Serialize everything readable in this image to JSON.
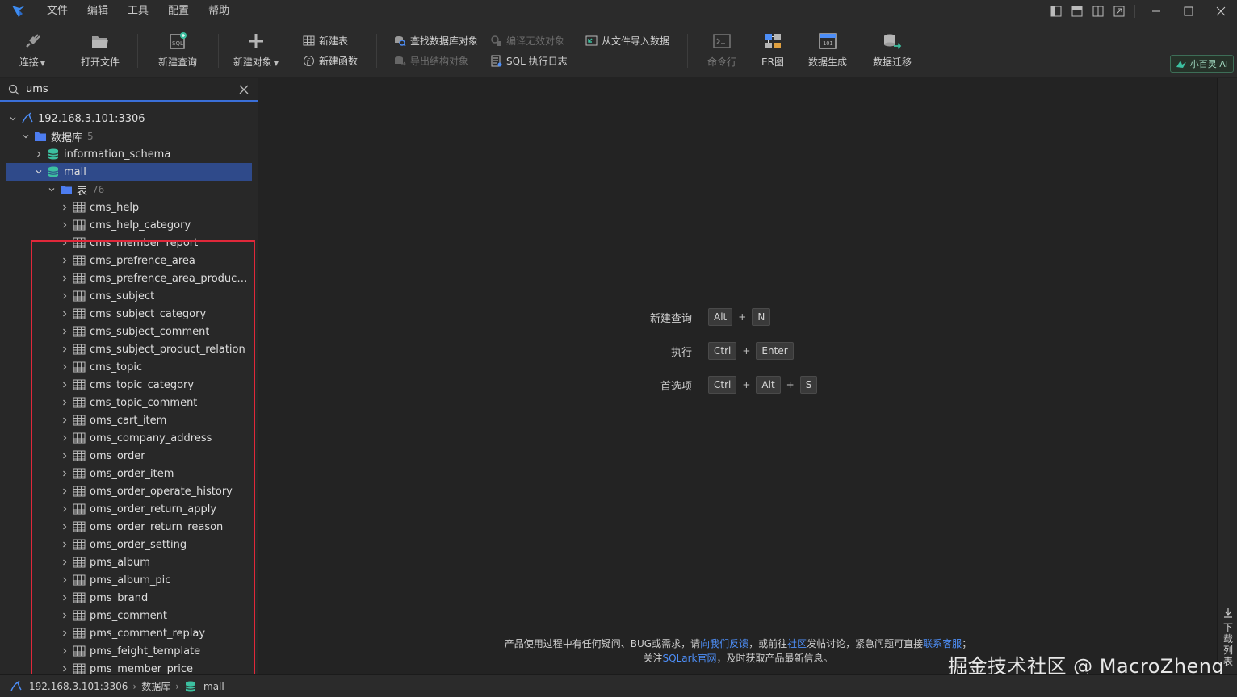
{
  "menu": [
    "文件",
    "编辑",
    "工具",
    "配置",
    "帮助"
  ],
  "toolbar": {
    "connect": "连接",
    "open_file": "打开文件",
    "new_query": "新建查询",
    "new_object": "新建对象",
    "new_table": "新建表",
    "new_function": "新建函数",
    "find_db_object": "查找数据库对象",
    "export_structure": "导出结构对象",
    "compile_invalid": "编译无效对象",
    "sql_log": "SQL 执行日志",
    "import_from_file": "从文件导入数据",
    "command_line": "命令行",
    "er_diagram": "ER图",
    "data_gen": "数据生成",
    "data_migrate": "数据迁移",
    "ai_label": "小百灵 AI"
  },
  "search": {
    "value": "ums"
  },
  "tree": {
    "connection": "192.168.3.101:3306",
    "databases_label": "数据库",
    "databases_count": "5",
    "db_info_schema": "information_schema",
    "db_mall": "mall",
    "tables_label": "表",
    "tables_count": "76",
    "tables": [
      "cms_help",
      "cms_help_category",
      "cms_member_report",
      "cms_prefrence_area",
      "cms_prefrence_area_product_rela...",
      "cms_subject",
      "cms_subject_category",
      "cms_subject_comment",
      "cms_subject_product_relation",
      "cms_topic",
      "cms_topic_category",
      "cms_topic_comment",
      "oms_cart_item",
      "oms_company_address",
      "oms_order",
      "oms_order_item",
      "oms_order_operate_history",
      "oms_order_return_apply",
      "oms_order_return_reason",
      "oms_order_setting",
      "pms_album",
      "pms_album_pic",
      "pms_brand",
      "pms_comment",
      "pms_comment_replay",
      "pms_feight_template",
      "pms_member_price"
    ]
  },
  "shortcuts": {
    "new_query": {
      "label": "新建查询",
      "keys": [
        "Alt",
        "N"
      ]
    },
    "execute": {
      "label": "执行",
      "keys": [
        "Ctrl",
        "Enter"
      ]
    },
    "preferences": {
      "label": "首选项",
      "keys": [
        "Ctrl",
        "Alt",
        "S"
      ]
    },
    "plus": "+"
  },
  "footer": {
    "line1_a": "产品使用过程中有任何疑问、BUG或需求，请",
    "line1_link1": "向我们反馈",
    "line1_b": "，或前往",
    "line1_link2": "社区",
    "line1_c": "发帖讨论，紧急问题可直接",
    "line1_link3": "联系客服",
    "line1_d": "；",
    "line2_a": "关注",
    "line2_link": "SQLark官网",
    "line2_b": "，及时获取产品最新信息。"
  },
  "right_strip": {
    "download_list": "下载列表"
  },
  "watermark": "掘金技术社区 @ MacroZheng",
  "statusbar": {
    "connection": "192.168.3.101:3306",
    "databases": "数据库",
    "current_db": "mall"
  },
  "colors": {
    "accent": "#3a6fd8",
    "selected_row": "#2f4a8a",
    "highlight_border": "#e0283a",
    "db_icon": "#3cc0a0",
    "folder_icon": "#4d7df0",
    "link": "#4d8ef7"
  }
}
